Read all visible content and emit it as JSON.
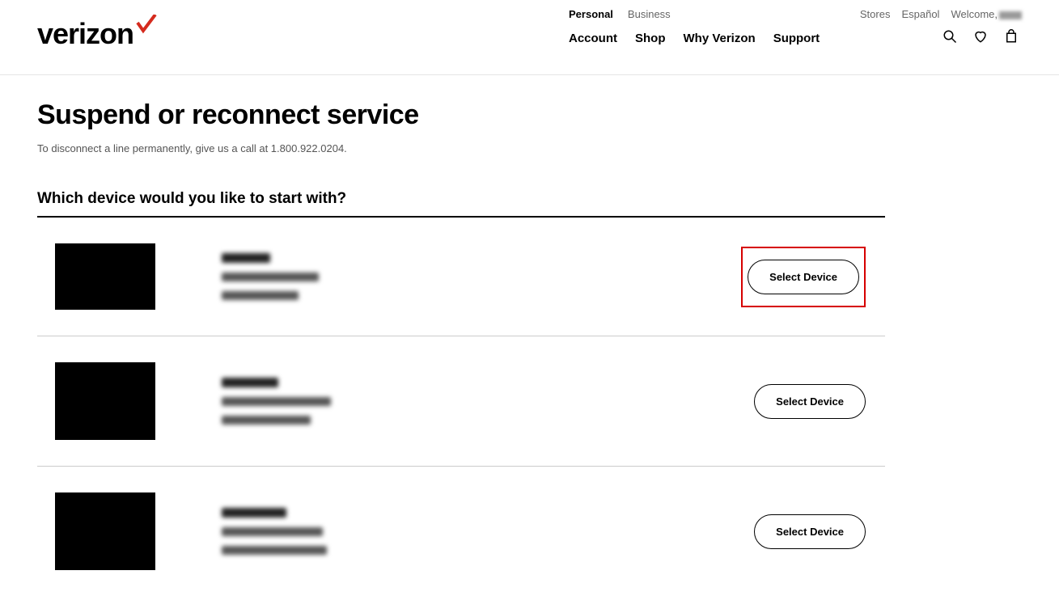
{
  "header": {
    "logo_text": "verizon",
    "top_links": {
      "personal": "Personal",
      "business": "Business",
      "stores": "Stores",
      "espanol": "Español",
      "welcome_prefix": "Welcome,"
    },
    "nav": {
      "account": "Account",
      "shop": "Shop",
      "why": "Why Verizon",
      "support": "Support"
    }
  },
  "page": {
    "title": "Suspend or reconnect service",
    "subtitle": "To disconnect a line permanently, give us a call at 1.800.922.0204.",
    "section_heading": "Which device would you like to start with?"
  },
  "buttons": {
    "select_device": "Select Device"
  }
}
